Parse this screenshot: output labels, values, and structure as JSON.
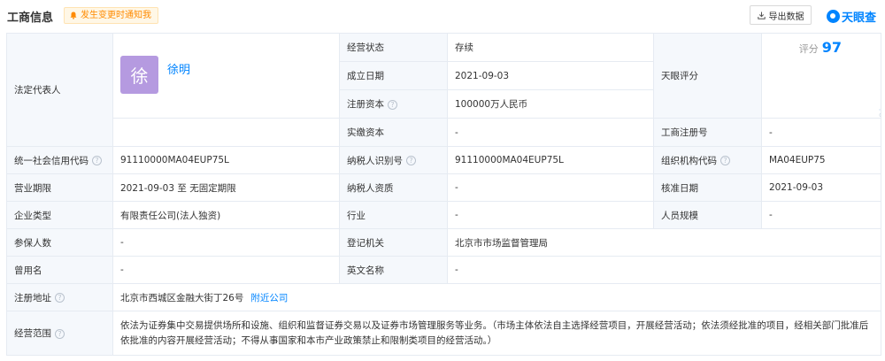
{
  "header": {
    "title": "工商信息",
    "notify_label": "发生变更时通知我",
    "export_label": "导出数据",
    "brand_name": "天眼查"
  },
  "rep": {
    "label": "法定代表人",
    "avatar_char": "徐",
    "name": "徐明"
  },
  "score": {
    "label": "天眼评分",
    "prefix": "评分",
    "value": "97",
    "value_number": 97,
    "axis_ticks": [
      "0",
      "1",
      "8",
      "15",
      "50",
      "65",
      "67",
      "80",
      "100"
    ]
  },
  "rows": {
    "status_label": "经营状态",
    "status_value": "存续",
    "founded_label": "成立日期",
    "founded_value": "2021-09-03",
    "capital_label": "注册资本",
    "capital_value": "100000万人民币",
    "paid_label": "实缴资本",
    "paid_value": "-",
    "regno_label": "工商注册号",
    "regno_value": "-",
    "credit_label": "统一社会信用代码",
    "credit_value": "91110000MA04EUP75L",
    "taxid_label": "纳税人识别号",
    "taxid_value": "91110000MA04EUP75L",
    "org_label": "组织机构代码",
    "org_value": "MA04EUP75",
    "term_label": "营业期限",
    "term_value": "2021-09-03  至 无固定期限",
    "taxq_label": "纳税人资质",
    "taxq_value": "-",
    "approve_label": "核准日期",
    "approve_value": "2021-09-03",
    "type_label": "企业类型",
    "type_value": "有限责任公司(法人独资)",
    "industry_label": "行业",
    "industry_value": "-",
    "staff_label": "人员规模",
    "staff_value": "-",
    "insured_label": "参保人数",
    "insured_value": "-",
    "authority_label": "登记机关",
    "authority_value": "北京市市场监督管理局",
    "formername_label": "曾用名",
    "formername_value": "-",
    "english_label": "英文名称",
    "english_value": "-",
    "address_label": "注册地址",
    "address_value": "北京市西城区金融大街丁26号",
    "address_link": "附近公司",
    "scope_label": "经营范围",
    "scope_value": "依法为证券集中交易提供场所和设施、组织和监督证券交易以及证券市场管理服务等业务。（市场主体依法自主选择经营项目，开展经营活动；依法须经批准的项目，经相关部门批准后依批准的内容开展经营活动；不得从事国家和本市产业政策禁止和限制类项目的经营活动。）"
  },
  "help_icon_char": "?",
  "colors": {
    "accent": "#0084ff",
    "label_bg": "#f5f8fc",
    "border": "#e6ebf2",
    "notify_text": "#ff8a00",
    "avatar_bg": "#b59ae0"
  }
}
